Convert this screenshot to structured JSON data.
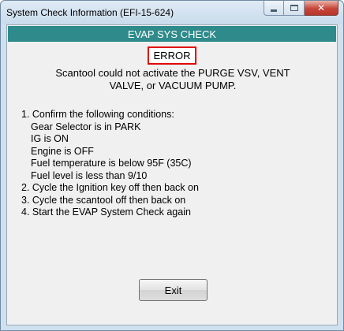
{
  "window": {
    "title": "System Check Information (EFI-15-624)"
  },
  "header": {
    "title": "EVAP SYS CHECK"
  },
  "status": {
    "label": "ERROR"
  },
  "message": {
    "line1": "Scantool could not activate the PURGE VSV, VENT",
    "line2": "VALVE, or VACUUM PUMP."
  },
  "steps": [
    "1. Confirm the following conditions:",
    "Gear Selector is in PARK",
    "IG is ON",
    "Engine is OFF",
    "Fuel temperature is below 95F (35C)",
    "Fuel level is less than 9/10",
    "2. Cycle the Ignition key off then back on",
    "3. Cycle the scantool off then back on",
    "4. Start the EVAP System Check again"
  ],
  "buttons": {
    "exit": "Exit"
  },
  "icons": {
    "minimize": "minimize-icon",
    "maximize": "maximize-icon",
    "close": "close-icon"
  },
  "colors": {
    "header_bg": "#2f8b8b",
    "error_border": "#e00000",
    "close_button": "#c7443a"
  }
}
